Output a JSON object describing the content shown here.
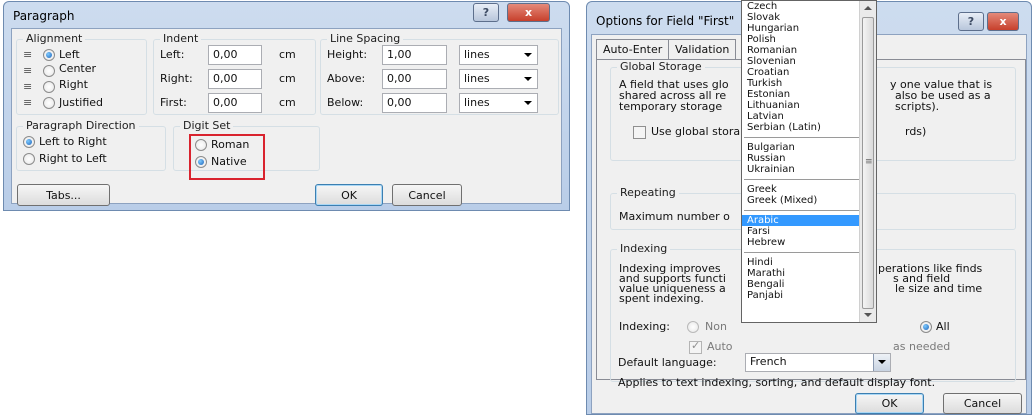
{
  "paragraph": {
    "title": "Paragraph",
    "help_glyph": "?",
    "close_glyph": "x",
    "alignment": {
      "label": "Alignment",
      "options": [
        "Left",
        "Center",
        "Right",
        "Justified"
      ],
      "selected": "Left"
    },
    "indent": {
      "label": "Indent",
      "rows": [
        {
          "label": "Left:",
          "value": "0,00",
          "unit": "cm"
        },
        {
          "label": "Right:",
          "value": "0,00",
          "unit": "cm"
        },
        {
          "label": "First:",
          "value": "0,00",
          "unit": "cm"
        }
      ]
    },
    "line_spacing": {
      "label": "Line Spacing",
      "rows": [
        {
          "label": "Height:",
          "value": "1,00",
          "unit": "lines"
        },
        {
          "label": "Above:",
          "value": "0,00",
          "unit": "lines"
        },
        {
          "label": "Below:",
          "value": "0,00",
          "unit": "lines"
        }
      ]
    },
    "direction": {
      "label": "Paragraph Direction",
      "options": [
        "Left to Right",
        "Right to Left"
      ],
      "selected": "Left to Right"
    },
    "digit_set": {
      "label": "Digit Set",
      "options": [
        "Roman",
        "Native"
      ],
      "selected": "Native",
      "highlight_color": "#d9232e"
    },
    "tabs_button": "Tabs...",
    "ok_button": "OK",
    "cancel_button": "Cancel"
  },
  "options": {
    "title": "Options for Field \"First\"",
    "help_glyph": "?",
    "close_glyph": "x",
    "tabs": [
      "Auto-Enter",
      "Validation"
    ],
    "global_storage": {
      "label": "Global Storage",
      "text_left": [
        "A field that uses glo",
        "shared across all re",
        "temporary storage"
      ],
      "text_right": [
        "y one value that is",
        "also be used as a",
        "scripts)."
      ],
      "checkbox_left": "Use global stora",
      "checkbox_right": "rds)"
    },
    "repeating": {
      "label": "Repeating",
      "text": "Maximum number o"
    },
    "indexing": {
      "label": "Indexing",
      "text_left": [
        "Indexing improves",
        "and supports functi",
        "value uniqueness a",
        "spent indexing."
      ],
      "text_right": [
        "perations like finds",
        "s and field",
        "le size and time"
      ],
      "indexing_label": "Indexing:",
      "radio_none": "Non",
      "radio_all": "All",
      "auto_left": "Auto",
      "auto_right": "as needed",
      "default_language_label": "Default language:",
      "default_language_value": "French",
      "footer_text": "Applies to text indexing, sorting, and default display font."
    },
    "ok_button": "OK",
    "cancel_button": "Cancel"
  },
  "language_list": {
    "groups": [
      [
        "Czech",
        "Slovak",
        "Hungarian",
        "Polish",
        "Romanian",
        "Slovenian",
        "Croatian",
        "Turkish",
        "Estonian",
        "Lithuanian",
        "Latvian",
        "Serbian (Latin)"
      ],
      [
        "Bulgarian",
        "Russian",
        "Ukrainian"
      ],
      [
        "Greek",
        "Greek (Mixed)"
      ],
      [
        "Arabic",
        "Farsi",
        "Hebrew"
      ],
      [
        "Hindi",
        "Marathi",
        "Bengali",
        "Panjabi"
      ]
    ],
    "selected": "Arabic",
    "selection_color": "#3399ff"
  }
}
